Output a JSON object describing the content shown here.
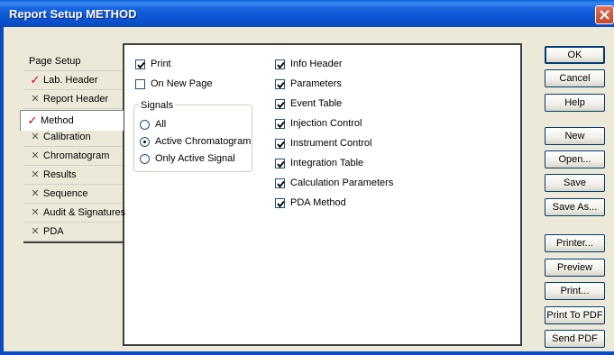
{
  "window": {
    "title": "Report Setup METHOD"
  },
  "tabs": [
    {
      "label": "Page Setup",
      "marker": "",
      "state": "plain"
    },
    {
      "label": "Lab. Header",
      "marker": "✓",
      "state": "checked"
    },
    {
      "label": "Report Header",
      "marker": "✕",
      "state": "unchecked"
    },
    {
      "label": "Method",
      "marker": "✓",
      "state": "active"
    },
    {
      "label": "Calibration",
      "marker": "✕",
      "state": "unchecked"
    },
    {
      "label": "Chromatogram",
      "marker": "✕",
      "state": "unchecked"
    },
    {
      "label": "Results",
      "marker": "✕",
      "state": "unchecked"
    },
    {
      "label": "Sequence",
      "marker": "✕",
      "state": "unchecked"
    },
    {
      "label": "Audit & Signatures",
      "marker": "✕",
      "state": "unchecked"
    },
    {
      "label": "PDA",
      "marker": "✕",
      "state": "unchecked"
    }
  ],
  "options": {
    "print": {
      "label": "Print",
      "checked": true
    },
    "on_new_page": {
      "label": "On New Page",
      "checked": false
    }
  },
  "signals": {
    "title": "Signals",
    "options": [
      {
        "label": "All",
        "selected": false
      },
      {
        "label": "Active Chromatogram",
        "selected": true
      },
      {
        "label": "Only Active Signal",
        "selected": false
      }
    ]
  },
  "sections": [
    {
      "label": "Info Header",
      "checked": true
    },
    {
      "label": "Parameters",
      "checked": true
    },
    {
      "label": "Event Table",
      "checked": true
    },
    {
      "label": "Injection Control",
      "checked": true
    },
    {
      "label": "Instrument Control",
      "checked": true
    },
    {
      "label": "Integration Table",
      "checked": true
    },
    {
      "label": "Calculation Parameters",
      "checked": true
    },
    {
      "label": "PDA Method",
      "checked": true
    }
  ],
  "buttons": {
    "ok": "OK",
    "cancel": "Cancel",
    "help": "Help",
    "new": "New",
    "open": "Open...",
    "save": "Save",
    "save_as": "Save As...",
    "printer": "Printer...",
    "preview": "Preview",
    "print": "Print...",
    "print_to_pdf": "Print To PDF",
    "send_pdf": "Send PDF"
  }
}
